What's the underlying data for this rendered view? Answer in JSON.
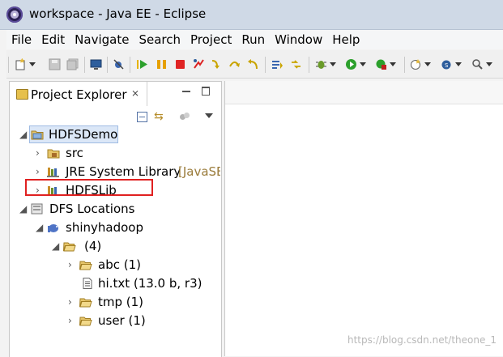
{
  "window": {
    "title": "workspace - Java EE - Eclipse"
  },
  "menu": [
    "File",
    "Edit",
    "Navigate",
    "Search",
    "Project",
    "Run",
    "Window",
    "Help"
  ],
  "toolbar": {
    "icons": [
      "new-icon",
      "save-icon",
      "save-all-icon",
      "terminal-icon",
      "skip-breakpoints-icon",
      "resume-icon",
      "suspend-icon",
      "terminate-icon",
      "disconnect-icon",
      "step-into-icon",
      "step-over-icon",
      "step-return-icon",
      "drop-to-frame-icon",
      "debug-icon",
      "run-icon",
      "external-tools-icon",
      "new-server-icon",
      "new-class-icon"
    ]
  },
  "project_explorer": {
    "title": "Project Explorer",
    "close_glyph": "⨯",
    "tree": {
      "project": "HDFSDemo",
      "src": "src",
      "jre": "JRE System Library",
      "jre_decoration": "[JavaSE",
      "hdfslib": "HDFSLib",
      "dfs": "DFS Locations",
      "location": "shinyhadoop",
      "root": "(4)",
      "abc": "abc (1)",
      "hi": "hi.txt (13.0 b, r3)",
      "tmp": "tmp (1)",
      "user": "user (1)"
    }
  },
  "watermark": "https://blog.csdn.net/theone_1"
}
